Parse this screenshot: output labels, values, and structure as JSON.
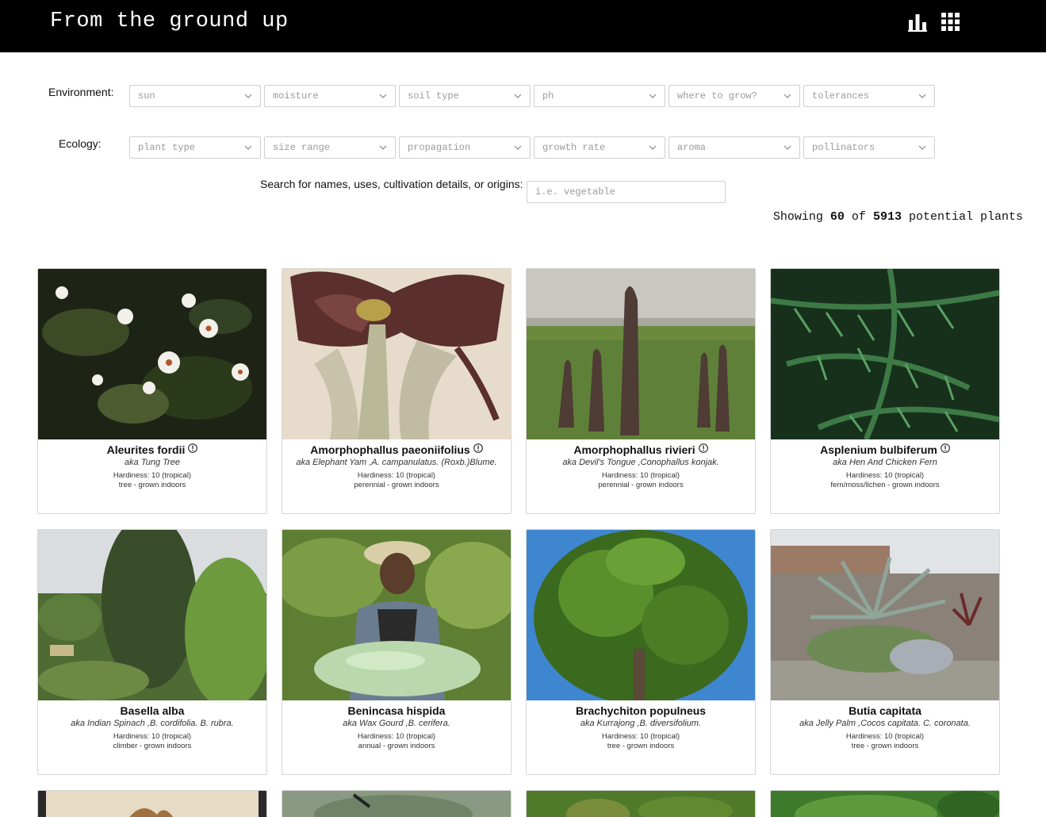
{
  "header": {
    "title": "From the ground up",
    "icons": [
      "bar-chart-icon",
      "grid-icon"
    ]
  },
  "filters": {
    "environment": {
      "label": "Environment:",
      "selects": [
        "sun",
        "moisture",
        "soil type",
        "ph",
        "where to grow?",
        "tolerances"
      ]
    },
    "ecology": {
      "label": "Ecology:",
      "selects": [
        "plant type",
        "size range",
        "propagation",
        "growth rate",
        "aroma",
        "pollinators"
      ]
    }
  },
  "search": {
    "label": "Search for names, uses, cultivation details, or origins:",
    "placeholder": "i.e. vegetable"
  },
  "results": {
    "prefix": "Showing",
    "shown": "60",
    "middle": "of",
    "total": "5913",
    "suffix": "potential plants"
  },
  "plants": [
    {
      "name": "Aleurites fordii",
      "aka": "aka Tung Tree",
      "hardiness": "Hardiness: 10 (tropical)",
      "type": "tree - grown indoors",
      "info": true,
      "image": "white-flowers"
    },
    {
      "name": "Amorphophallus paeoniifolius",
      "aka": "aka Elephant Yam ,A. campanulatus. (Roxb.)Blume.",
      "hardiness": "Hardiness: 10 (tropical)",
      "type": "perennial - grown indoors",
      "info": true,
      "image": "botanical-illustration"
    },
    {
      "name": "Amorphophallus rivieri",
      "aka": "aka Devil's Tongue ,Conophallus konjak.",
      "hardiness": "Hardiness: 10 (tropical)",
      "type": "perennial - grown indoors",
      "info": true,
      "image": "spathes-on-grass"
    },
    {
      "name": "Asplenium bulbiferum",
      "aka": "aka Hen And Chicken Fern",
      "hardiness": "Hardiness: 10 (tropical)",
      "type": "fern/moss/lichen - grown indoors",
      "info": true,
      "image": "fern-fronds"
    },
    {
      "name": "Basella alba",
      "aka": "aka Indian Spinach ,B. cordifolia. B. rubra.",
      "hardiness": "Hardiness: 10 (tropical)",
      "type": "climber - grown indoors",
      "info": false,
      "image": "climber-garden"
    },
    {
      "name": "Benincasa hispida",
      "aka": "aka Wax Gourd ,B. cerifera.",
      "hardiness": "Hardiness: 10 (tropical)",
      "type": "annual - grown indoors",
      "info": false,
      "image": "man-with-gourd"
    },
    {
      "name": "Brachychiton populneus",
      "aka": "aka Kurrajong ,B. diversifolium.",
      "hardiness": "Hardiness: 10 (tropical)",
      "type": "tree - grown indoors",
      "info": false,
      "image": "tree-blue-sky"
    },
    {
      "name": "Butia capitata",
      "aka": "aka Jelly Palm ,Cocos capitata. C. coronata.",
      "hardiness": "Hardiness: 10 (tropical)",
      "type": "tree - grown indoors",
      "info": false,
      "image": "palm-by-wall"
    }
  ],
  "colors": {
    "header_bg": "#000000",
    "header_text": "#ffffff",
    "placeholder": "#9a9a9a",
    "border": "#d6d6d6"
  }
}
